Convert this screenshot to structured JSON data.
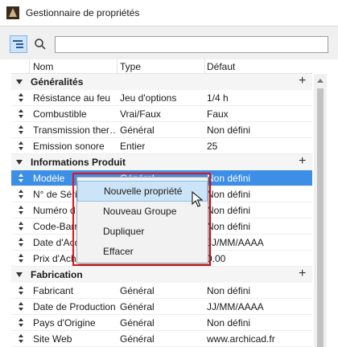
{
  "window": {
    "title": "Gestionnaire de propriétés"
  },
  "toolbar": {
    "search_value": ""
  },
  "columns": {
    "name": "Nom",
    "type": "Type",
    "default": "Défaut"
  },
  "groups": [
    {
      "name": "Généralités",
      "properties": [
        {
          "name": "Résistance au feu",
          "type": "Jeu d'options",
          "default": "1/4 h"
        },
        {
          "name": "Combustible",
          "type": "Vrai/Faux",
          "default": "Faux"
        },
        {
          "name": "Transmission ther…",
          "type": "Général",
          "default": "Non défini"
        },
        {
          "name": "Emission sonore",
          "type": "Entier",
          "default": "25"
        }
      ]
    },
    {
      "name": "Informations Produit",
      "properties": [
        {
          "name": "Modèle",
          "type": "Général",
          "default": "Non défini"
        },
        {
          "name": "N° de Série",
          "type": "",
          "default": "Non défini"
        },
        {
          "name": "Numéro d",
          "type": "",
          "default": "Non défini"
        },
        {
          "name": "Code-Barre",
          "type": "",
          "default": "Non défini"
        },
        {
          "name": "Date d'Acq",
          "type": "",
          "default": "JJ/MM/AAAA"
        },
        {
          "name": "Prix d'Acha",
          "type": "",
          "default": "0.00"
        }
      ]
    },
    {
      "name": "Fabrication",
      "properties": [
        {
          "name": "Fabricant",
          "type": "Général",
          "default": "Non défini"
        },
        {
          "name": "Date de Production",
          "type": "Général",
          "default": "JJ/MM/AAAA"
        },
        {
          "name": "Pays d'Origine",
          "type": "Général",
          "default": "Non défini"
        },
        {
          "name": "Site Web",
          "type": "Général",
          "default": "www.archicad.fr"
        }
      ]
    }
  ],
  "context_menu": {
    "items": [
      "Nouvelle propriété",
      "Nouveau Groupe",
      "Dupliquer",
      "Effacer"
    ],
    "hovered": "Nouvelle propriété"
  },
  "colors": {
    "selection": "#3c8ee6",
    "menu_highlight": "#cce4f7",
    "annotation_outline": "#e0131c"
  }
}
